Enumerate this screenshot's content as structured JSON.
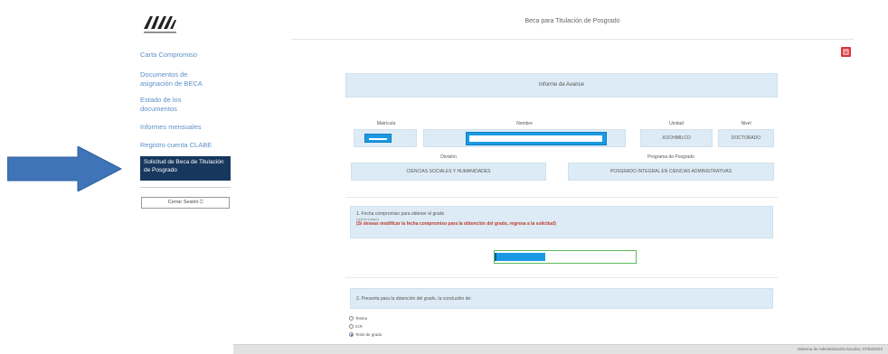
{
  "header": {
    "title": "Beca para Titulación de Posgrado"
  },
  "sidebar": {
    "items": [
      {
        "label": "Carta Compromiso"
      },
      {
        "label": "Documentos de asignación de BECA"
      },
      {
        "label": "Estado de los documentos"
      },
      {
        "label": "Informes mensuales"
      },
      {
        "label": "Registro cuenta CLABE"
      },
      {
        "label": "Solicitud de Beca de Titulación de Posgrado"
      }
    ],
    "logout_label": "Cerrar Sesión"
  },
  "form": {
    "section_title": "Informe de Avance",
    "labels": {
      "matricula": "Matrícula",
      "nombre": "Nombre",
      "unidad": "Unidad",
      "nivel": "Nivel",
      "division": "División",
      "programa": "Programa de Posgrado"
    },
    "values": {
      "unidad": "XOCHIMILCO",
      "nivel": "DOCTORADO",
      "division": "CIENCIAS SOCIALES Y HUMANIDADES",
      "programa": "POSGRADO INTEGRAL EN CIENCIAS ADMINISTRATIVAS"
    },
    "question1": {
      "text": "1. Fecha compromiso para obtener el grado",
      "hint": "(dd/mm/aaaa)",
      "warning": "(Si deseas modificar la fecha compromiso para la obtención del grado, regresa a la solicitud)"
    },
    "question2": {
      "text": "2. Presenta para la obtención del grado, la conclusión de:",
      "options": [
        "Tesina",
        "ICR",
        "Tesis de grado"
      ],
      "selected": "Tesis de grado"
    }
  },
  "footer": {
    "text": "Sistema de Administración Escolar, 07/03/2023"
  },
  "colors": {
    "sidebar_active_bg": "#17375e",
    "panel_bg": "#dcebf5",
    "highlight": "#1a9ae3",
    "warning": "#c0392b",
    "arrow": "#3f74b8",
    "pdf_button": "#d9363e"
  },
  "icons": [
    "arrow-annotation-icon",
    "uam-logo",
    "logout-icon",
    "pdf-icon"
  ]
}
